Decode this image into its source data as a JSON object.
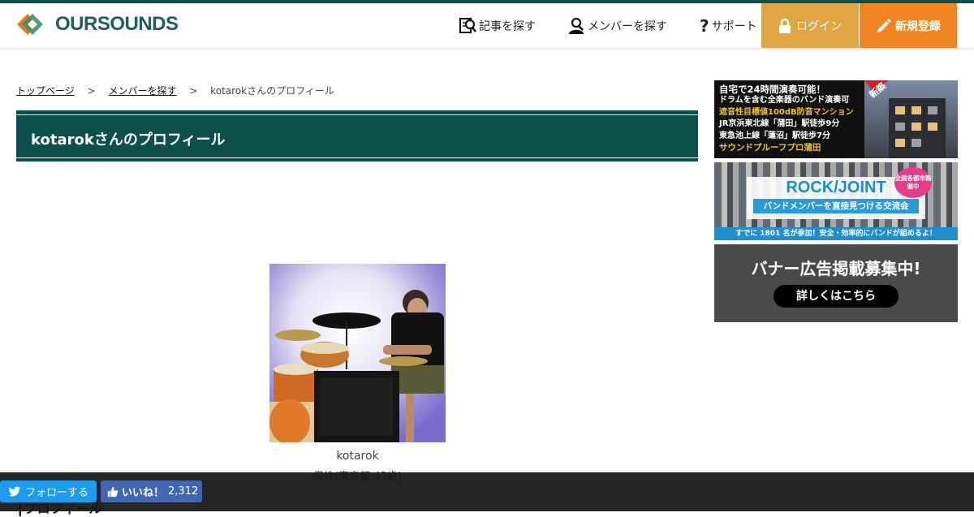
{
  "header": {
    "logo_text": "OURSOUNDS",
    "nav": [
      {
        "icon": "search-document-icon",
        "label": "記事を探す"
      },
      {
        "icon": "search-member-icon",
        "label": "メンバーを探す"
      },
      {
        "icon": "question-icon",
        "label": "サポート"
      }
    ],
    "login_label": "ログイン",
    "register_label": "新規登録"
  },
  "breadcrumb": {
    "items": [
      "トップページ",
      "メンバーを探す",
      "kotarokさんのプロフィール"
    ],
    "separator": ">"
  },
  "page_title": "kotarokさんのプロフィール",
  "profile": {
    "username": "kotarok",
    "info": "男性(東京都 43歳)",
    "section_heading": "プロフィール"
  },
  "banners": [
    {
      "lines": [
        "自宅で24時間演奏可能！",
        "ドラムを含む全楽器のバンド演奏可",
        "遮音性目標値100dB防音マンション",
        "JR京浜東北線「蒲田」駅徒歩9分",
        "東急池上線「蓮沼」駅徒歩7分",
        "サウンドプルーフプロ蒲田"
      ],
      "badge": "新築"
    },
    {
      "title": "ROCK/JOINT",
      "subtitle": "バンドメンバーを直接見つける交流会",
      "footer": "すでに 1801 名が参加！安全・効率的にバンドが組めるよ！",
      "badge": "全国各都市開催中"
    },
    {
      "title": "バナー広告掲載募集中!",
      "button": "詳しくはこちら"
    }
  ],
  "social": {
    "twitter_label": "フォローする",
    "like_label": "いいね！",
    "like_count": "2,312"
  },
  "colors": {
    "brand": "#0c4f4b",
    "login": "#e1a544",
    "register": "#f08420",
    "twitter": "#1d9bf0",
    "facebook": "#4267b2"
  }
}
